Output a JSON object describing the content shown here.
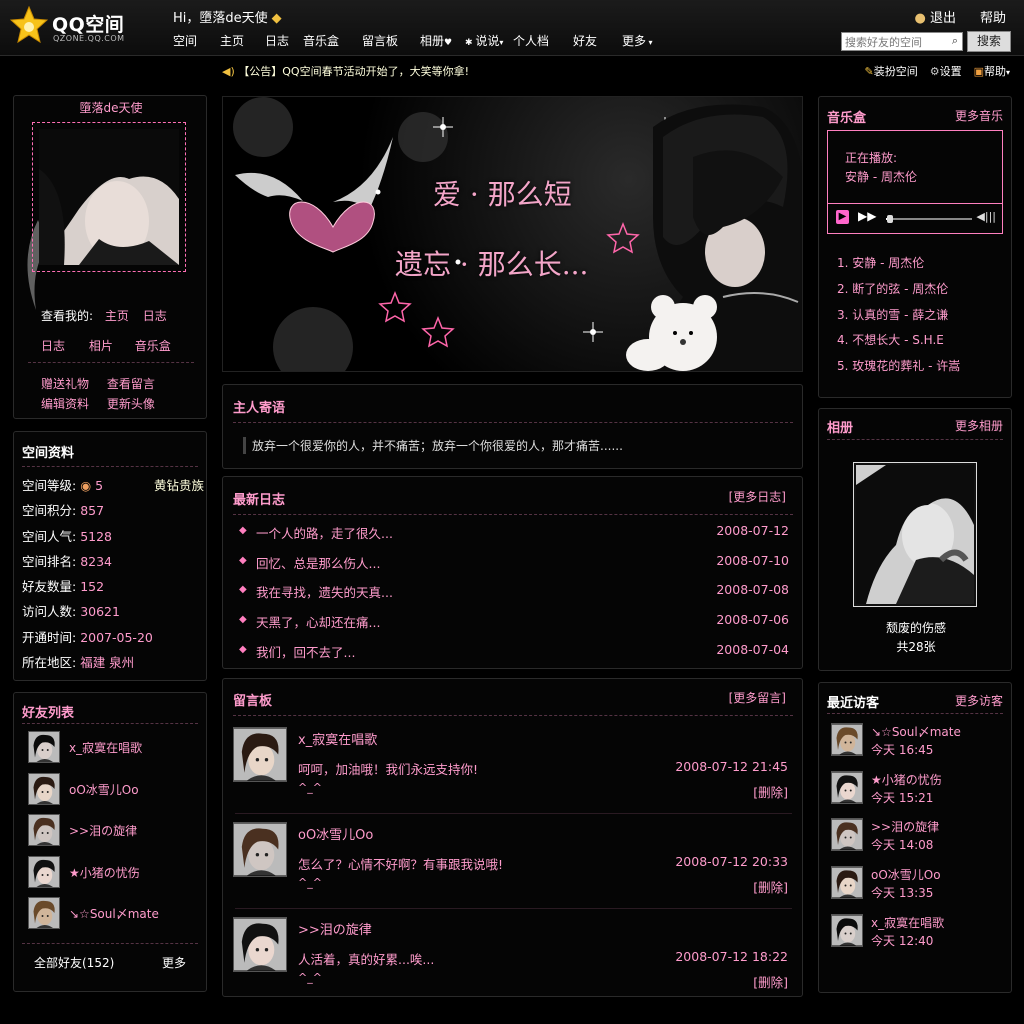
{
  "app": {
    "logo_text": "QQ空间",
    "logo_sub": "QZONE.QQ.COM",
    "greeting": "Hi，墮落de天使",
    "logout": "退出",
    "help": "帮助"
  },
  "nav": {
    "items": [
      "空间",
      "主页",
      "日志",
      "音乐盒",
      "留言板",
      "相册",
      "说说",
      "个人档",
      "好友",
      "更多"
    ]
  },
  "search": {
    "placeholder": "搜索好友的空间",
    "button": "搜索"
  },
  "notice": "【公告】QQ空间春节活动开始了，大笑等你拿!",
  "tools": {
    "dress": "装扮空间",
    "settings": "设置",
    "help": "帮助"
  },
  "profile": {
    "name": "墮落de天使",
    "view_label": "查看我的:",
    "links": [
      "主页",
      "日志",
      "日志",
      "相片",
      "音乐盒"
    ],
    "actions": [
      "赠送礼物",
      "查看留言",
      "编辑资料",
      "更新头像"
    ]
  },
  "info": {
    "title": "空间资料",
    "rows": [
      {
        "k": "空间等级:",
        "v": "5",
        "extra": "黄钻贵族"
      },
      {
        "k": "空间积分:",
        "v": "857"
      },
      {
        "k": "空间人气:",
        "v": "5128"
      },
      {
        "k": "空间排名:",
        "v": "8234"
      },
      {
        "k": "好友数量:",
        "v": "152"
      },
      {
        "k": "访问人数:",
        "v": "30621"
      },
      {
        "k": "开通时间:",
        "v": "2007-05-20"
      },
      {
        "k": "所在地区:",
        "v": "福建 泉州"
      }
    ]
  },
  "friends": {
    "title": "好友列表",
    "items": [
      "x_寂寞在唱歌",
      "oO冰雪儿Oo",
      ">>泪の旋律",
      "★小猪の忧伤",
      "↘☆Soul〆mate"
    ],
    "all": "全部好友(152)",
    "more": "更多"
  },
  "banner": {
    "line1": "爱 · 那么短",
    "line2": "遗忘 · 那么长..."
  },
  "owner_msg": {
    "title": "主人寄语",
    "text": "放弃一个很爱你的人，并不痛苦；放弃一个你很爱的人，那才痛苦......"
  },
  "blog": {
    "title": "最新日志",
    "more": "[更多日志]",
    "items": [
      {
        "t": "一个人的路，走了很久...",
        "d": "2008-07-12"
      },
      {
        "t": "回忆、总是那么伤人...",
        "d": "2008-07-10"
      },
      {
        "t": "我在寻找，遗失的天真...",
        "d": "2008-07-08"
      },
      {
        "t": "天黑了，心却还在痛...",
        "d": "2008-07-06"
      },
      {
        "t": "我们，回不去了...",
        "d": "2008-07-04"
      }
    ]
  },
  "guestbook": {
    "title": "留言板",
    "more": "[更多留言]",
    "delete": "[删除]",
    "items": [
      {
        "name": "x_寂寞在唱歌",
        "msg": "呵呵，加油哦！我们永远支持你!",
        "emo": "^_^",
        "time": "2008-07-12 21:45"
      },
      {
        "name": "oO冰雪儿Oo",
        "msg": "怎么了？心情不好啊？有事跟我说哦!",
        "emo": "^_^",
        "time": "2008-07-12 20:33"
      },
      {
        "name": ">>泪の旋律",
        "msg": "人活着，真的好累...唉...",
        "emo": "^_^",
        "time": "2008-07-12 18:22"
      }
    ]
  },
  "music": {
    "title": "音乐盒",
    "more": "更多音乐",
    "now_label": "正在播放:",
    "now": "安静 - 周杰伦",
    "progress": 0.05,
    "list": [
      "1. 安静 - 周杰伦",
      "2. 断了的弦 - 周杰伦",
      "3. 认真的雪 - 薛之谦",
      "4. 不想长大 - S.H.E",
      "5. 玫瑰花的葬礼 - 许嵩"
    ]
  },
  "album": {
    "title": "相册",
    "more": "更多相册",
    "name": "颓废的伤感",
    "count": "共28张"
  },
  "visitors": {
    "title": "最近访客",
    "more": "更多访客",
    "items": [
      {
        "n": "↘☆Soul〆mate",
        "t": "今天 16:45"
      },
      {
        "n": "★小猪の忧伤",
        "t": "今天 15:21"
      },
      {
        "n": ">>泪の旋律",
        "t": "今天 14:08"
      },
      {
        "n": "oO冰雪儿Oo",
        "t": "今天 13:35"
      },
      {
        "n": "x_寂寞在唱歌",
        "t": "今天 12:40"
      }
    ]
  },
  "colors": {
    "accent": "#ff9ccc",
    "bg": "#000000",
    "panel_border": "#2a2a2a"
  }
}
